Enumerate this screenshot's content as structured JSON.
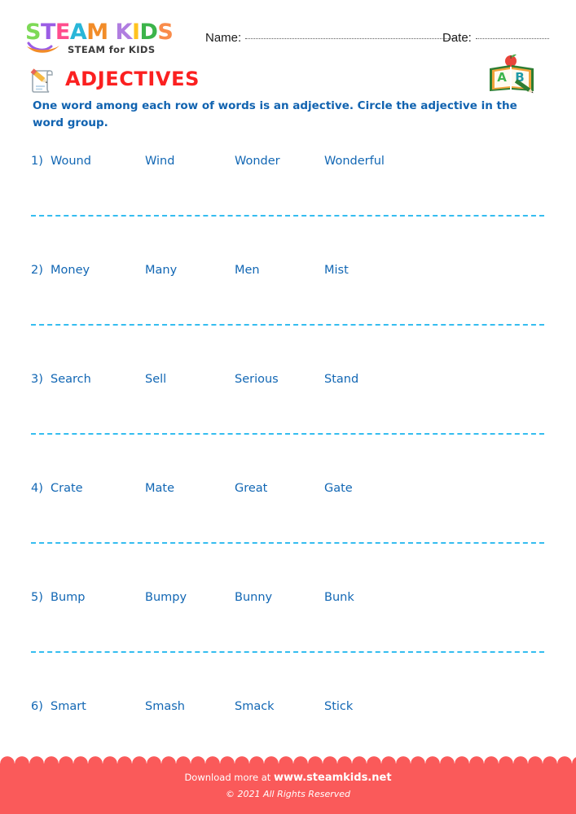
{
  "brand": {
    "logo_letters": [
      {
        "ch": "S",
        "color": "#7ed957"
      },
      {
        "ch": "T",
        "color": "#9b5de5"
      },
      {
        "ch": "E",
        "color": "#ff4d8d"
      },
      {
        "ch": "A",
        "color": "#29b6d8"
      },
      {
        "ch": "M",
        "color": "#f28c28"
      },
      {
        "ch": " ",
        "color": "#ffffff"
      },
      {
        "ch": "K",
        "color": "#b07de0"
      },
      {
        "ch": "I",
        "color": "#ffc31f"
      },
      {
        "ch": "D",
        "color": "#3cb44b"
      },
      {
        "ch": "S",
        "color": "#f98c4b"
      }
    ],
    "logo_text": "STEAM KIDS",
    "tagline": "STEAM for KIDS",
    "swoosh_colors": [
      "#9b5de5",
      "#f28c28"
    ]
  },
  "header": {
    "name_label": "Name:",
    "date_label": "Date:"
  },
  "title": {
    "text": "ADJECTIVES",
    "color": "#fb2020",
    "icon": "pencil-paper-icon",
    "right_icon": "abc-book-icon"
  },
  "instructions": {
    "text": "One word among each row of words is an adjective. Circle the adjective in the word group.",
    "color": "#1163b0"
  },
  "worksheet": {
    "word_color": "#1267b4",
    "separator_color": "#35bdf0",
    "rows": [
      {
        "number": "1)",
        "words": [
          "Wound",
          "Wind",
          "Wonder",
          "Wonderful"
        ]
      },
      {
        "number": "2)",
        "words": [
          "Money",
          "Many",
          "Men",
          "Mist"
        ]
      },
      {
        "number": "3)",
        "words": [
          "Search",
          "Sell",
          "Serious",
          "Stand"
        ]
      },
      {
        "number": "4)",
        "words": [
          "Crate",
          "Mate",
          "Great",
          "Gate"
        ]
      },
      {
        "number": "5)",
        "words": [
          "Bump",
          "Bumpy",
          "Bunny",
          "Bunk"
        ]
      },
      {
        "number": "6)",
        "words": [
          "Smart",
          "Smash",
          "Smack",
          "Stick"
        ]
      }
    ]
  },
  "footer": {
    "background": "#fa5a5a",
    "download_prefix": "Download more at ",
    "url": "www.steamkids.net",
    "copyright": "© 2021 All Rights Reserved"
  }
}
